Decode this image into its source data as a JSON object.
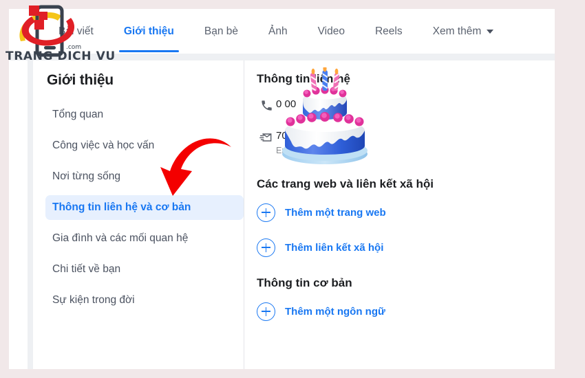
{
  "theme": {
    "accent": "#1877f2",
    "page_bg": "#f1e8e9",
    "card_bg": "#ffffff",
    "gutter": "#eef0f3",
    "active_item_bg": "#e7f0fe",
    "muted_text": "#4b5260",
    "arrow_red": "#f40000"
  },
  "watermark": {
    "brand": "TRANG DICH VU",
    "tld": ".com",
    "icon": "phone-logo-icon"
  },
  "tabs": [
    {
      "label": "Bài viết",
      "active": false,
      "icon": null
    },
    {
      "label": "Giới thiệu",
      "active": true,
      "icon": null
    },
    {
      "label": "Bạn bè",
      "active": false,
      "icon": null
    },
    {
      "label": "Ảnh",
      "active": false,
      "icon": null
    },
    {
      "label": "Video",
      "active": false,
      "icon": null
    },
    {
      "label": "Reels",
      "active": false,
      "icon": null
    },
    {
      "label": "Xem thêm",
      "active": false,
      "icon": "chevron-down-icon"
    }
  ],
  "sidebar": {
    "title": "Giới thiệu",
    "items": [
      {
        "label": "Tổng quan",
        "active": false
      },
      {
        "label": "Công việc và học vấn",
        "active": false
      },
      {
        "label": "Nơi từng sống",
        "active": false
      },
      {
        "label": "Thông tin liên hệ và cơ bản",
        "active": true
      },
      {
        "label": "Gia đình và các mối quan hệ",
        "active": false
      },
      {
        "label": "Chi tiết về bạn",
        "active": false
      },
      {
        "label": "Sự kiện trong đời",
        "active": false
      }
    ]
  },
  "content": {
    "contact_section": {
      "title": "Thông tin liên hệ",
      "rows": [
        {
          "icon": "phone-icon",
          "value": "0           00",
          "sub": ""
        },
        {
          "icon": "email-icon",
          "value": "         70@gmail.com",
          "sub": "Email"
        }
      ]
    },
    "websites_section": {
      "title": "Các trang web và liên kết xã hội",
      "actions": [
        {
          "icon": "plus-circle-icon",
          "label": "Thêm một trang web"
        },
        {
          "icon": "plus-circle-icon",
          "label": "Thêm liên kết xã hội"
        }
      ]
    },
    "basic_section": {
      "title": "Thông tin cơ bản",
      "actions": [
        {
          "icon": "plus-circle-icon",
          "label": "Thêm một ngôn ngữ"
        }
      ]
    }
  },
  "annotations": {
    "arrow": {
      "name": "red-arrow-annotation",
      "color": "#f40000",
      "points_to": "Thông tin liên hệ và cơ bản"
    },
    "sticker": {
      "name": "birthday-cake-sticker"
    }
  }
}
